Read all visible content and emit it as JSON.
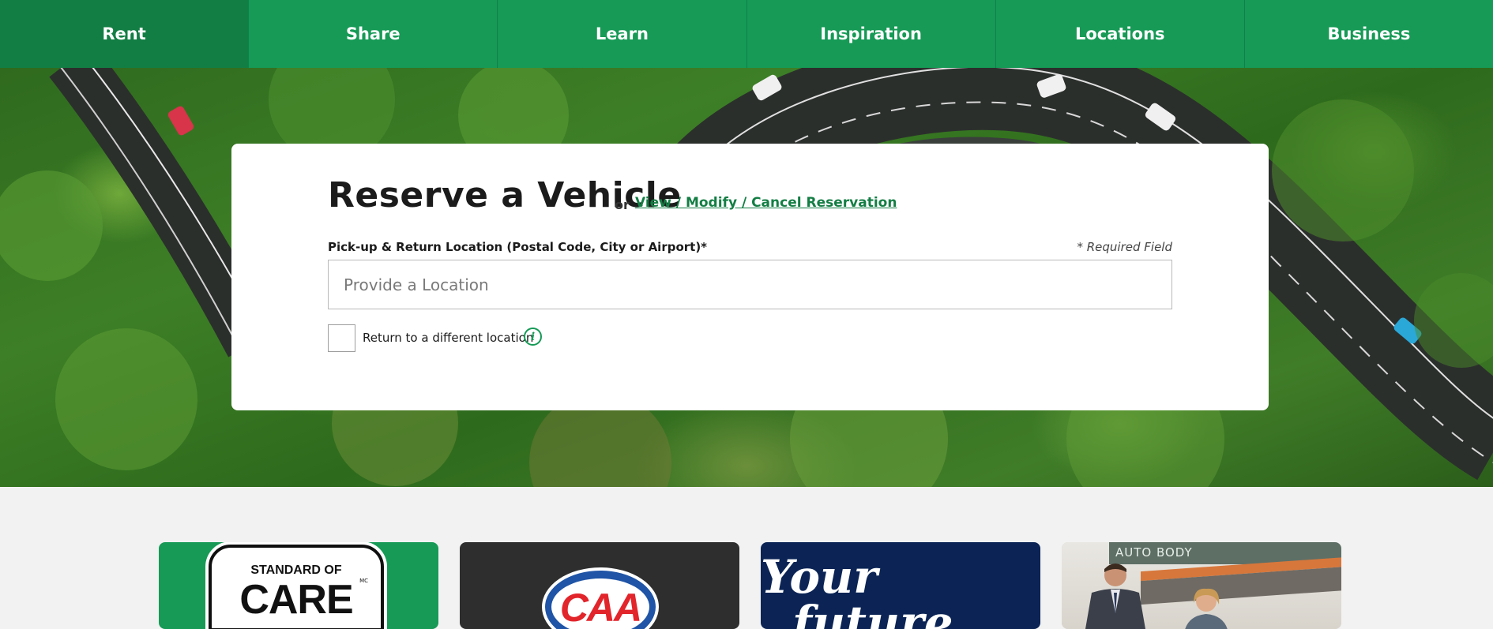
{
  "nav": {
    "items": [
      {
        "label": "Rent",
        "active": true
      },
      {
        "label": "Share",
        "active": false
      },
      {
        "label": "Learn",
        "active": false
      },
      {
        "label": "Inspiration",
        "active": false
      },
      {
        "label": "Locations",
        "active": false
      },
      {
        "label": "Business",
        "active": false
      }
    ]
  },
  "reserve": {
    "title": "Reserve a Vehicle",
    "or": "or",
    "manage_link": "View / Modify / Cancel Reservation",
    "location_label": "Pick-up & Return Location (Postal Code, City or Airport)*",
    "required_note": "* Required Field",
    "location_placeholder": "Provide a Location",
    "location_value": "",
    "return_checkbox_label": "Return to a different location",
    "return_checkbox_checked": false,
    "info_icon": "i"
  },
  "promos": {
    "tile1": {
      "badge_top": "STANDARD OF",
      "badge_main": "CARE",
      "badge_mark": "MC"
    },
    "tile2": {
      "logo": "CAA"
    },
    "tile3": {
      "line1": "Your",
      "line2": "future"
    },
    "tile4": {
      "sign": "AUTO BODY"
    }
  },
  "colors": {
    "brand_green": "#169a56",
    "nav_active": "#137e44",
    "link_green": "#137e44",
    "caa_blue": "#1f54a6",
    "caa_red": "#e2242b",
    "navy": "#0b2455"
  }
}
